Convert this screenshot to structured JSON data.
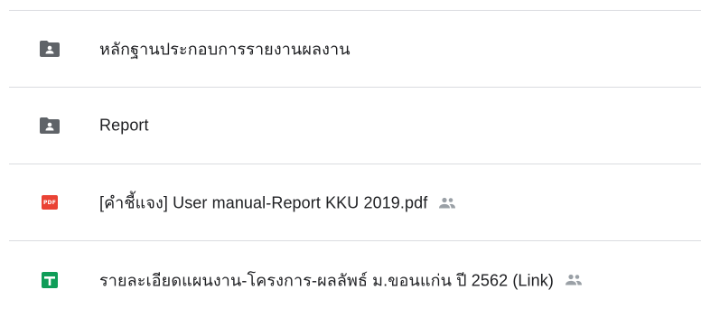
{
  "files": [
    {
      "name": "หลักฐานประกอบการรายงานผลงาน",
      "type": "folder-shared",
      "shared": false
    },
    {
      "name": "Report",
      "type": "folder-shared",
      "shared": false
    },
    {
      "name": "[คำชี้แจง] User manual-Report KKU 2019.pdf",
      "type": "pdf",
      "badge": "PDF",
      "shared": true
    },
    {
      "name": "รายละเอียดแผนงาน-โครงการ-ผลลัพธ์ ม.ขอนแก่น ปี 2562 (Link)",
      "type": "google-sheets",
      "shared": true
    }
  ],
  "colors": {
    "folder_icon": "#5f6368",
    "pdf_icon": "#ea4335",
    "sheets_icon": "#0f9d58",
    "shared_icon": "#9aa0a6",
    "divider": "#dadce0",
    "text": "#202124"
  }
}
